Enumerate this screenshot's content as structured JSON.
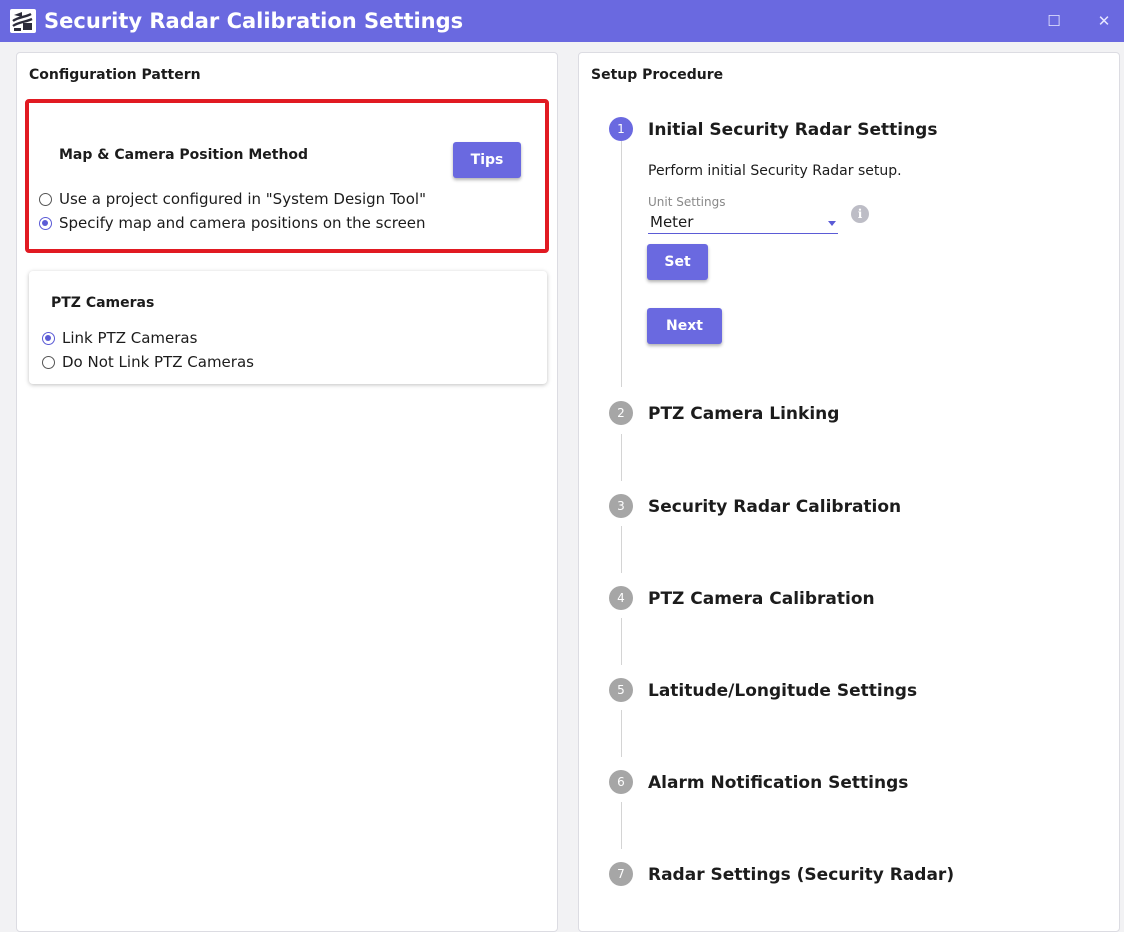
{
  "window": {
    "title": "Security Radar Calibration Settings",
    "maximize_glyph": "☐",
    "close_glyph": "✕"
  },
  "left_panel": {
    "title": "Configuration Pattern",
    "map_card": {
      "title": "Map & Camera Position Method",
      "tips_label": "Tips",
      "options": [
        {
          "label": "Use a project configured in \"System Design Tool\"",
          "checked": false
        },
        {
          "label": "Specify map and camera positions on the screen",
          "checked": true
        }
      ]
    },
    "ptz_card": {
      "title": "PTZ Cameras",
      "options": [
        {
          "label": "Link PTZ Cameras",
          "checked": true
        },
        {
          "label": "Do Not Link PTZ Cameras",
          "checked": false
        }
      ]
    }
  },
  "right_panel": {
    "title": "Setup Procedure",
    "steps": [
      {
        "number": "1",
        "label": "Initial Security Radar Settings",
        "active": true
      },
      {
        "number": "2",
        "label": "PTZ Camera Linking",
        "active": false
      },
      {
        "number": "3",
        "label": "Security Radar Calibration",
        "active": false
      },
      {
        "number": "4",
        "label": "PTZ Camera Calibration",
        "active": false
      },
      {
        "number": "5",
        "label": "Latitude/Longitude Settings",
        "active": false
      },
      {
        "number": "6",
        "label": "Alarm Notification Settings",
        "active": false
      },
      {
        "number": "7",
        "label": "Radar Settings (Security Radar)",
        "active": false
      }
    ],
    "step1": {
      "description": "Perform initial Security Radar setup.",
      "unit_label": "Unit Settings",
      "unit_value": "Meter",
      "info_glyph": "i",
      "set_label": "Set",
      "next_label": "Next"
    }
  },
  "colors": {
    "accent": "#6a69e0",
    "highlight_border": "#e11a22",
    "inactive_step": "#a6a6a6"
  }
}
